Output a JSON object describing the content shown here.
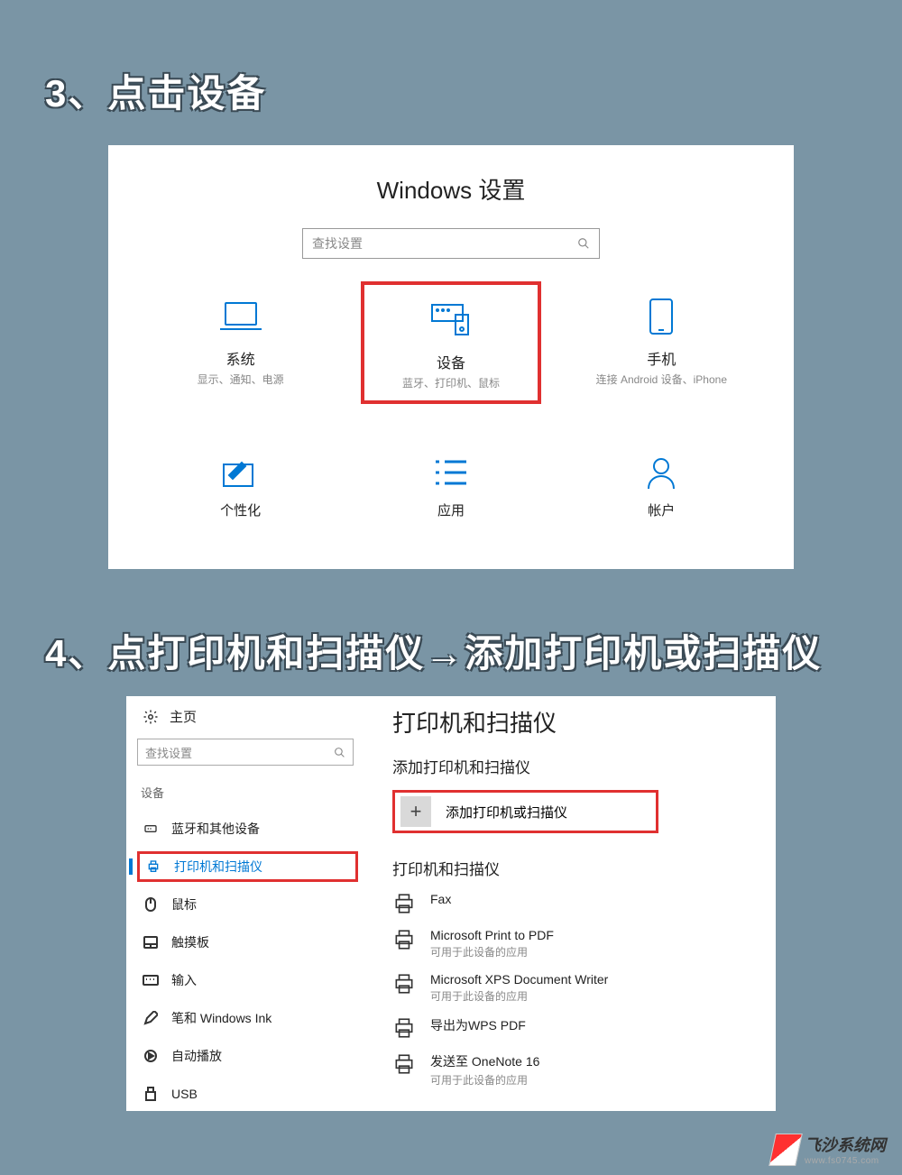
{
  "step3": {
    "heading": "3、点击设备"
  },
  "panel1": {
    "title": "Windows 设置",
    "search_placeholder": "查找设置",
    "tiles_row1": [
      {
        "key": "system",
        "title": "系统",
        "sub": "显示、通知、电源"
      },
      {
        "key": "devices",
        "title": "设备",
        "sub": "蓝牙、打印机、鼠标"
      },
      {
        "key": "phone",
        "title": "手机",
        "sub": "连接 Android 设备、iPhone"
      }
    ],
    "tiles_row2": [
      {
        "key": "personalization",
        "title": "个性化"
      },
      {
        "key": "apps",
        "title": "应用"
      },
      {
        "key": "accounts",
        "title": "帐户"
      }
    ]
  },
  "step4": {
    "heading": "4、点打印机和扫描仪→添加打印机或扫描仪"
  },
  "panel2": {
    "home": "主页",
    "search_placeholder": "查找设置",
    "category": "设备",
    "sidebar_items": [
      {
        "key": "bluetooth",
        "label": "蓝牙和其他设备"
      },
      {
        "key": "printers",
        "label": "打印机和扫描仪"
      },
      {
        "key": "mouse",
        "label": "鼠标"
      },
      {
        "key": "touchpad",
        "label": "触摸板"
      },
      {
        "key": "typing",
        "label": "输入"
      },
      {
        "key": "pen",
        "label": "笔和 Windows Ink"
      },
      {
        "key": "autoplay",
        "label": "自动播放"
      },
      {
        "key": "usb",
        "label": "USB"
      }
    ],
    "main_title": "打印机和扫描仪",
    "add_section": "添加打印机和扫描仪",
    "add_label": "添加打印机或扫描仪",
    "list_title": "打印机和扫描仪",
    "printers": [
      {
        "name": "Fax",
        "sub": ""
      },
      {
        "name": "Microsoft Print to PDF",
        "sub": "可用于此设备的应用"
      },
      {
        "name": "Microsoft XPS Document Writer",
        "sub": "可用于此设备的应用"
      },
      {
        "name": "导出为WPS PDF",
        "sub": ""
      },
      {
        "name": "发送至 OneNote 16",
        "sub": "可用于此设备的应用"
      }
    ]
  },
  "watermark": {
    "name": "飞沙系统网",
    "url": "www.fs0745.com"
  }
}
